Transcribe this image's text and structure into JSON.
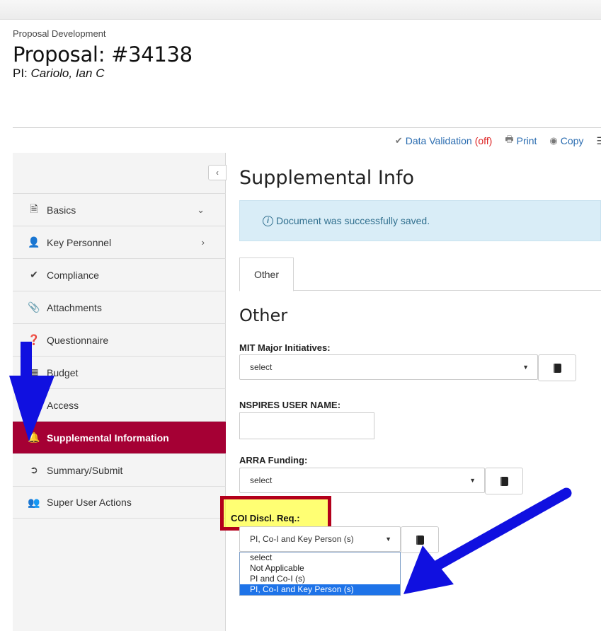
{
  "header": {
    "breadcrumb": "Proposal Development",
    "title": "Proposal: #34138",
    "pi_label": "PI:",
    "pi_name": "Cariolo, Ian C"
  },
  "toolbar": {
    "data_validation": "Data Validation",
    "data_validation_state": "(off)",
    "print": "Print",
    "copy": "Copy"
  },
  "sidebar": {
    "items": [
      {
        "label": "Basics",
        "icon": "document-icon",
        "chevron": "⌄"
      },
      {
        "label": "Key Personnel",
        "icon": "user-icon",
        "chevron": "›"
      },
      {
        "label": "Compliance",
        "icon": "check-icon"
      },
      {
        "label": "Attachments",
        "icon": "paperclip-icon"
      },
      {
        "label": "Questionnaire",
        "icon": "question-icon"
      },
      {
        "label": "Budget",
        "icon": "calculator-icon"
      },
      {
        "label": "Access",
        "icon": "lock-icon"
      },
      {
        "label": "Supplemental Information",
        "icon": "bell-icon",
        "active": true
      },
      {
        "label": "Summary/Submit",
        "icon": "submit-icon"
      },
      {
        "label": "Super User Actions",
        "icon": "admin-user-icon"
      }
    ]
  },
  "main": {
    "heading": "Supplemental Info",
    "alert": "Document was successfully saved.",
    "tab": "Other",
    "section_heading": "Other",
    "fields": {
      "mit_major_initiatives": {
        "label": "MIT Major Initiatives:",
        "value": "select"
      },
      "nspires_user_name": {
        "label": "NSPIRES USER NAME:",
        "value": ""
      },
      "arra_funding": {
        "label": "ARRA Funding:",
        "value": "select"
      },
      "coi_discl_req": {
        "label": "COI Discl. Req.:",
        "value": "PI, Co-I and Key Person (s)",
        "options": [
          "select",
          "Not Applicable",
          "PI and Co-I (s)",
          "PI, Co-I and Key Person (s)"
        ]
      }
    }
  },
  "colors": {
    "active_nav": "#a50034",
    "link": "#2a6cb0",
    "alert_bg": "#d9edf7",
    "annotation_arrow": "#1010e0",
    "highlight_border": "#b3001b",
    "highlight_fill": "#ffff00"
  }
}
